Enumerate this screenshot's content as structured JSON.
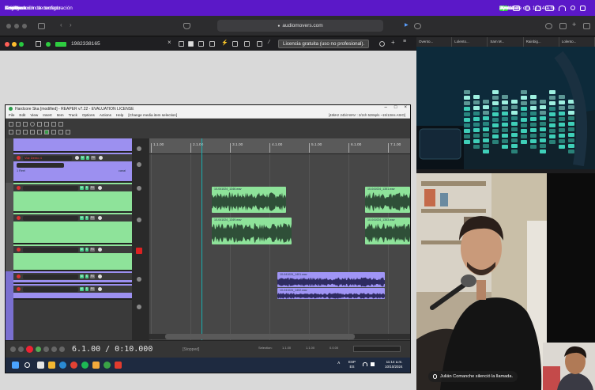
{
  "menubar": {
    "app": "AnyDesk",
    "items": [
      "Archivo",
      "Editar",
      "Visualización de configuración",
      "Acciones",
      "Configuración de teclado"
    ],
    "right_items": [
      "Permisos",
      "Ventana",
      "Ayuda"
    ],
    "battery": "50%",
    "clock": "Jue 10 de oct. 11:14 a.m."
  },
  "browser": {
    "url": "audiomovers.com"
  },
  "remote": {
    "session_id": "1982338165",
    "license_label": "Licencia gratuita (uso no profesional)."
  },
  "reaper": {
    "title": "Hardcore Ska [modified] - REAPER v7.22 - EVALUATION LICENSE",
    "menu": [
      "File",
      "Edit",
      "View",
      "Insert",
      "Item",
      "Track",
      "Options",
      "Actions",
      "Help",
      "[Change media item selection]"
    ],
    "info": "[48kHz 24bit WAV : 2/2ch 528spls ~15/13ms ASIO]",
    "tracks": [
      {
        "name": "Voz Demo 4",
        "sub": "1 Reel",
        "sub_right": "canal"
      }
    ],
    "ruler": [
      "1.1.00",
      "2.1.00",
      "3.1.00",
      "4.1.00",
      "5.1.00",
      "6.1.00",
      "7.1.00"
    ],
    "items": [
      {
        "label": "10-041024_1346.wav"
      },
      {
        "label": "10-041024_1351.wav"
      },
      {
        "label": "10-041024_1349.wav"
      },
      {
        "label": "10-041024_1353.wav"
      },
      {
        "label": "10-041024_1401.wav"
      },
      {
        "label": "10-041024_1402.wav"
      }
    ],
    "transport": {
      "time": "6.1.00 / 0:10.000",
      "status": "[Stopped]",
      "selection_labels": [
        "Selection:",
        "1.1.00",
        "1.1.00",
        "0.0.00"
      ]
    },
    "taskbar": {
      "lang": "ESP",
      "region": "ES",
      "time": "11:14 a.m.",
      "date": "10/10/2024"
    }
  },
  "call": {
    "tabs": [
      "Ovento...",
      "Lolento...",
      "Sam M...",
      "Rainbig...",
      "Lolento..."
    ],
    "toast": "Julián Comanche silenció la llamada."
  },
  "colors": {
    "menubar": "#5b18c8",
    "track_green": "#8ee39a",
    "track_purple": "#9c90f0"
  }
}
